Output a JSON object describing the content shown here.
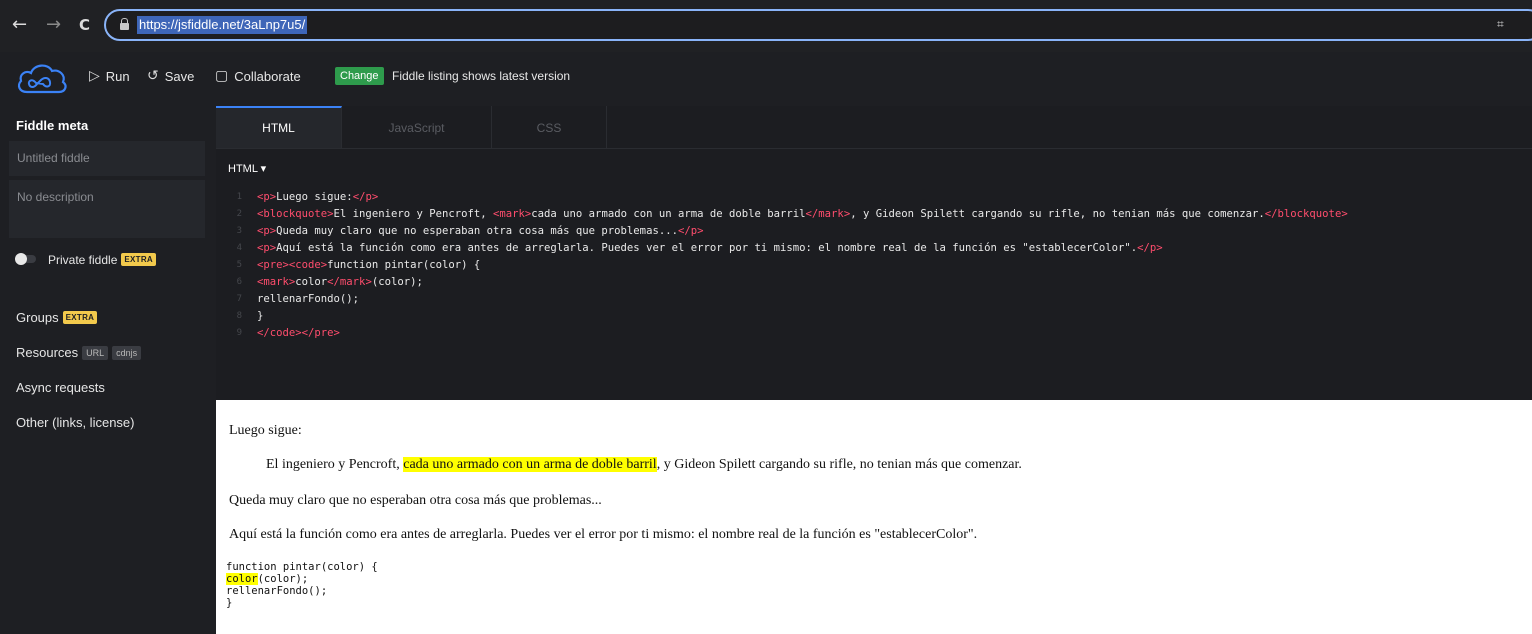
{
  "browser": {
    "url": "https://jsfiddle.net/3aLnp7u5/",
    "back_icon": "←",
    "forward_icon": "→",
    "reload_icon": "C"
  },
  "header": {
    "run_label": "Run",
    "save_label": "Save",
    "collaborate_label": "Collaborate",
    "change_label": "Change",
    "listing_text": "Fiddle listing shows latest version",
    "run_icon": "▷",
    "save_icon": "↺",
    "collaborate_icon": "▢"
  },
  "sidebar": {
    "title": "Fiddle meta",
    "name_placeholder": "Untitled fiddle",
    "description_placeholder": "No description",
    "private_label": "Private fiddle",
    "private_badge": "EXTRA",
    "groups_label": "Groups",
    "groups_badge": "EXTRA",
    "resources_label": "Resources",
    "resources_url": "URL",
    "resources_cdnjs": "cdnjs",
    "async_label": "Async requests",
    "other_label": "Other (links, license)"
  },
  "editor": {
    "tabs": [
      "HTML",
      "JavaScript",
      "CSS"
    ],
    "active_tab": "HTML",
    "language_label": "HTML ▾",
    "line_numbers": [
      "1",
      "2",
      "3",
      "4",
      "5",
      "6",
      "7",
      "8",
      "9"
    ],
    "lines": [
      [
        {
          "t": "<p>",
          "tag": true
        },
        {
          "t": "Luego sigue:"
        },
        {
          "t": "</p>",
          "tag": true
        }
      ],
      [
        {
          "t": "<blockquote>",
          "tag": true
        },
        {
          "t": "El ingeniero y Pencroft, "
        },
        {
          "t": "<mark>",
          "tag": true
        },
        {
          "t": "cada uno armado con un arma de doble barril"
        },
        {
          "t": "</mark>",
          "tag": true
        },
        {
          "t": ", y Gideon Spilett cargando su rifle, no tenian más que comenzar."
        },
        {
          "t": "</blockquote>",
          "tag": true
        }
      ],
      [
        {
          "t": "<p>",
          "tag": true
        },
        {
          "t": "Queda muy claro que no esperaban otra cosa más que problemas..."
        },
        {
          "t": "</p>",
          "tag": true
        }
      ],
      [
        {
          "t": "<p>",
          "tag": true
        },
        {
          "t": "Aquí está la función como era antes de arreglarla. Puedes ver el error por ti mismo: el nombre real de la función es \"establecerColor\"."
        },
        {
          "t": "</p>",
          "tag": true
        }
      ],
      [
        {
          "t": "<pre>",
          "tag": true
        },
        {
          "t": "<code>",
          "tag": true
        },
        {
          "t": "function pintar(color) {"
        }
      ],
      [
        {
          "t": "<mark>",
          "tag": true
        },
        {
          "t": "color"
        },
        {
          "t": "</mark>",
          "tag": true
        },
        {
          "t": "(color);"
        }
      ],
      [
        {
          "t": "rellenarFondo();"
        }
      ],
      [
        {
          "t": "}"
        }
      ],
      [
        {
          "t": "</code>",
          "tag": true
        },
        {
          "t": "</pre>",
          "tag": true
        }
      ]
    ]
  },
  "preview": {
    "p1": "Luego sigue:",
    "quote_before": "El ingeniero y Pencroft, ",
    "quote_mark": "cada uno armado con un arma de doble barril",
    "quote_after": ", y Gideon Spilett cargando su rifle, no tenian más que comenzar.",
    "p2": "Queda muy claro que no esperaban otra cosa más que problemas...",
    "p3": "Aquí está la función como era antes de arreglarla. Puedes ver el error por ti mismo: el nombre real de la función es \"establecerColor\".",
    "code_line1": "function pintar(color) {",
    "code_mark": "color",
    "code_line2_rest": "(color);",
    "code_line3": "rellenarFondo();",
    "code_line4": "}"
  },
  "colors": {
    "accent": "#3b82f6",
    "change_green": "#2e9b4c",
    "extra_badge": "#f2c94c",
    "tag_red": "#ff4d6d",
    "highlight": "#ffff00"
  }
}
